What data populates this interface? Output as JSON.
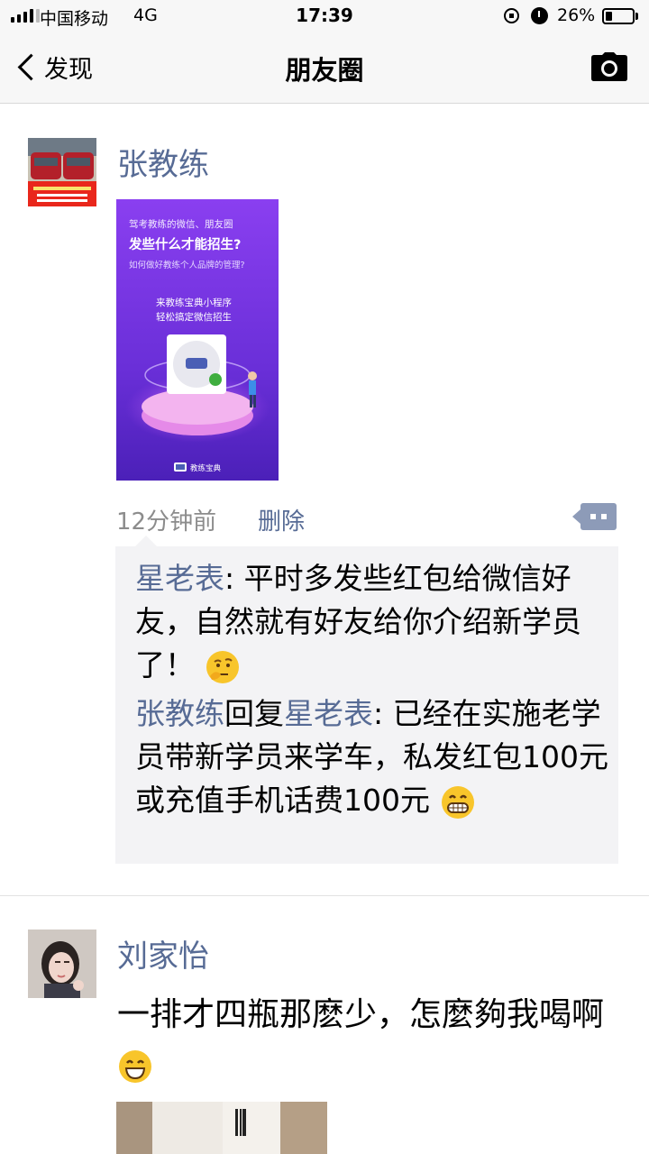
{
  "status_bar": {
    "carrier": "中国移动",
    "network": "4G",
    "time": "17:39",
    "battery_percent_label": "26%",
    "battery_level": 0.26
  },
  "nav": {
    "back_label": "发现",
    "title": "朋友圈"
  },
  "posts": [
    {
      "author": "张教练",
      "image": {
        "line1": "驾考教练的微信、朋友圈",
        "line2": "发些什么才能招生?",
        "line3": "如何做好教练个人品牌的管理?",
        "line4": "来教练宝典小程序",
        "line5": "轻松搞定微信招生",
        "footer": "教练宝典"
      },
      "time": "12分钟前",
      "delete_label": "删除",
      "comments": [
        {
          "name": "星老表",
          "text": ": 平时多发些红包给微信好友，自然就有好友给你介绍新学员了！"
        },
        {
          "name": "张教练",
          "reply_word": "回复",
          "reply_to": "星老表",
          "text": ": 已经在实施老学员带新学员来学车，私发红包100元或充值手机话费100元"
        }
      ]
    },
    {
      "author": "刘家怡",
      "text": "一排才四瓶那麽少，怎麼夠我喝啊"
    }
  ],
  "colors": {
    "name_blue": "#576b95",
    "meta_gray": "#8c8c8c",
    "comment_bg": "#f3f3f5",
    "promo_purple": "#7b3fe4"
  }
}
